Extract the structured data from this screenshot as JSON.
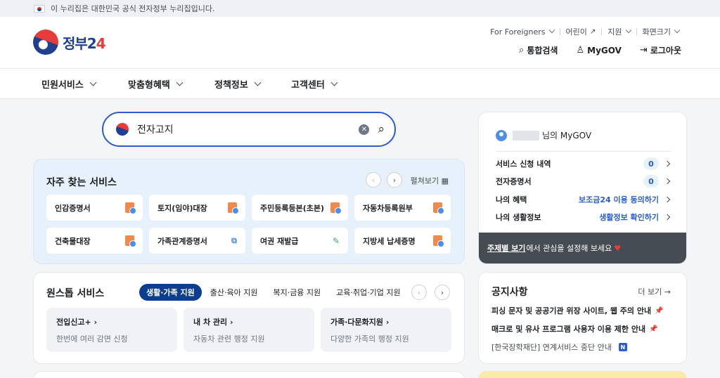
{
  "gov_banner": {
    "text": "이 누리집은 대한민국 공식 전자정부 누리집입니다."
  },
  "header": {
    "logo_text_main": "정부2",
    "logo_text_accent": "4",
    "util_links": [
      "For Foreigners",
      "어린이",
      "지원",
      "화면크기"
    ],
    "actions": {
      "search": "통합검색",
      "mygov": "MyGOV",
      "logout": "로그아웃"
    }
  },
  "gnb": [
    "민원서비스",
    "맞춤형혜택",
    "정책정보",
    "고객센터"
  ],
  "search": {
    "value": "전자고지"
  },
  "frequent": {
    "title": "자주 찾는 서비스",
    "view_all": "펼쳐보기",
    "items": [
      {
        "label": "인감증명서",
        "icon": "document-icon"
      },
      {
        "label": "토지(임야)대장",
        "icon": "document-icon"
      },
      {
        "label": "주민등록등본(초본)",
        "icon": "document-icon"
      },
      {
        "label": "자동차등록원부",
        "icon": "document-icon"
      },
      {
        "label": "건축물대장",
        "icon": "document-icon"
      },
      {
        "label": "가족관계증명서",
        "icon": "external-link-icon"
      },
      {
        "label": "여권 재발급",
        "icon": "pencil-icon"
      },
      {
        "label": "지방세 납세증명",
        "icon": "document-icon"
      }
    ]
  },
  "onestop": {
    "title": "원스톱 서비스",
    "tabs": [
      "생활·가족 지원",
      "출산·육아 지원",
      "복지·금융 지원",
      "교육·취업·기업 지원"
    ],
    "cards": [
      {
        "title": "전입신고+",
        "desc": "한번에 여러 감면 신청"
      },
      {
        "title": "내 차 관리",
        "desc": "자동차 관련 행정 지원"
      },
      {
        "title": "가족·다문화지원",
        "desc": "다양한 가족의 행정 지원"
      }
    ]
  },
  "mygov": {
    "greeting_suffix": "님의 MyGOV",
    "rows": [
      {
        "label": "서비스 신청 내역",
        "count": "0"
      },
      {
        "label": "전자증명서",
        "count": "0"
      },
      {
        "label": "나의 혜택",
        "link": "보조금24 이용 동의하기"
      },
      {
        "label": "나의 생활정보",
        "link": "생활정보 확인하기"
      }
    ],
    "banner_link": "주제별 보기",
    "banner_text": "에서 관심을 설정해 보세요"
  },
  "notice": {
    "title": "공지사항",
    "more": "더 보기 →",
    "items": [
      "피싱 문자 및 공공기관 위장 사이트, 웹 주의 안내",
      "매크로 및 유사 프로그램 사용자 이용 제한 안내",
      "[한국장학재단] 연계서비스 중단 안내"
    ],
    "new_badge": "N"
  },
  "colors": {
    "accent": "#2a5ec9",
    "brand_navy": "#0b3d91",
    "brand_red": "#e63c3c"
  }
}
